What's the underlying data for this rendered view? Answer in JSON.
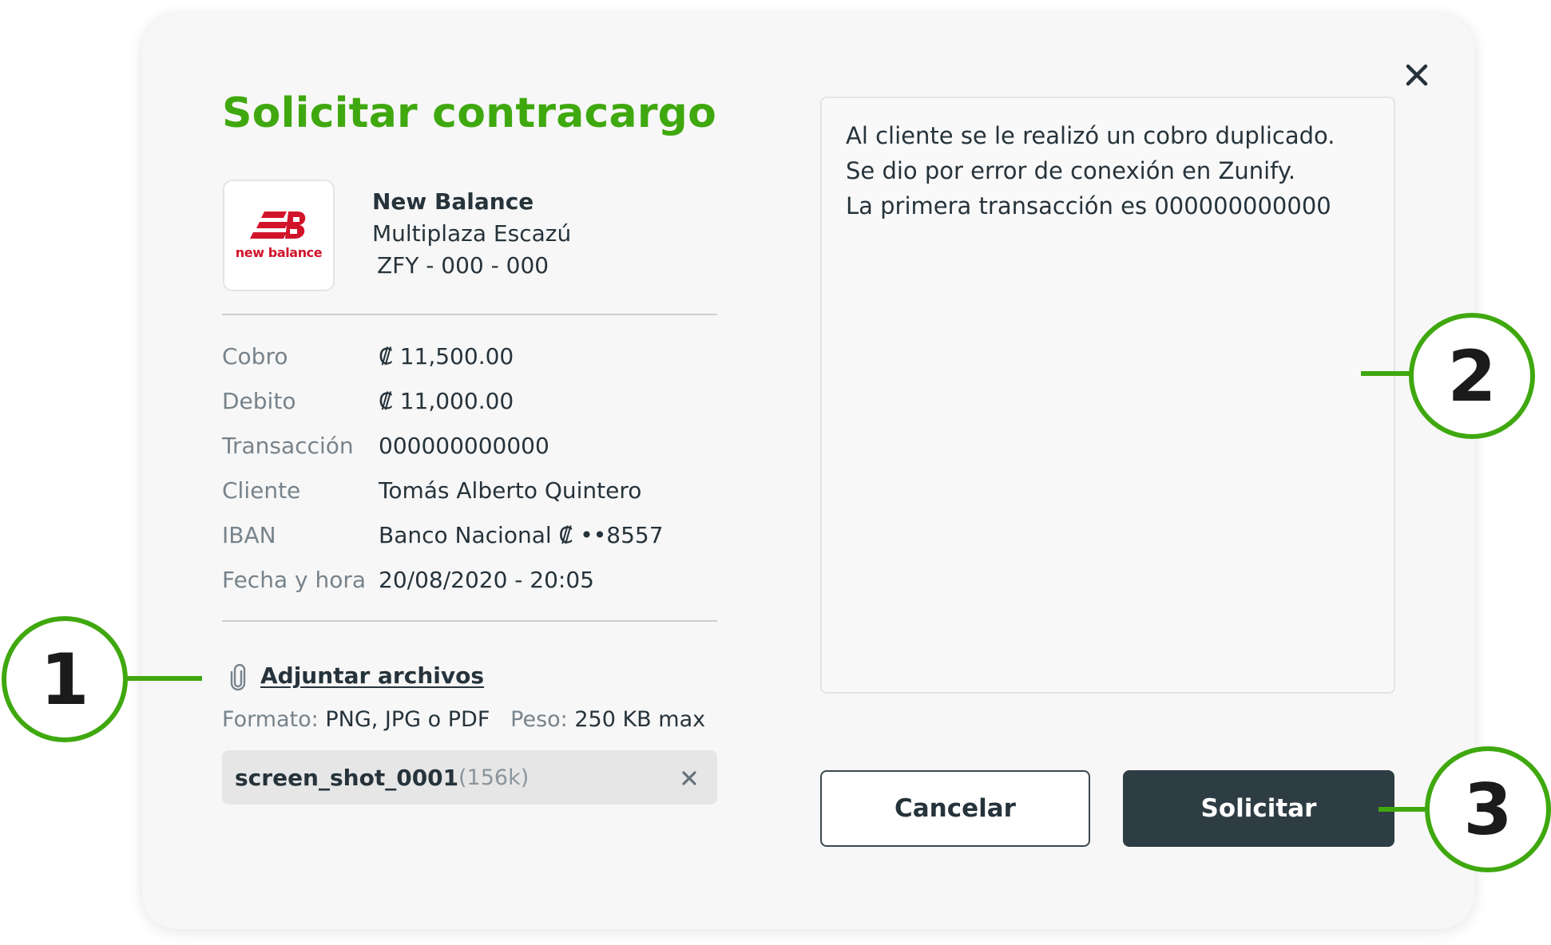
{
  "modal": {
    "title": "Solicitar contracargo",
    "close_icon": "close-icon"
  },
  "merchant": {
    "logo_text": "new balance",
    "name": "New Balance",
    "branch": "Multiplaza Escazú",
    "code": "ZFY - 000 - 000"
  },
  "details": [
    {
      "label": "Cobro",
      "value": "₡ 11,500.00"
    },
    {
      "label": "Debito",
      "value": "₡ 11,000.00"
    },
    {
      "label": "Transacción",
      "value": "000000000000"
    },
    {
      "label": "Cliente",
      "value": "Tomás Alberto Quintero"
    },
    {
      "label": "IBAN",
      "value": "Banco Nacional ₡ ••8557"
    },
    {
      "label": "Fecha y hora",
      "value": "20/08/2020 - 20:05"
    }
  ],
  "attachments": {
    "link_label": "Adjuntar archivos",
    "icon": "paperclip-icon",
    "format_label": "Formato:",
    "format_value": "PNG, JPG o PDF",
    "weight_label": "Peso:",
    "weight_value": "250 KB max",
    "file": {
      "name": "screen_shot_0001",
      "size": "(156k)",
      "remove_icon": "close-icon"
    }
  },
  "reason": {
    "lines": [
      "Al cliente se le realizó un cobro duplicado.",
      "Se dio por error de conexión en Zunify.",
      "La primera transacción es 000000000000"
    ]
  },
  "actions": {
    "cancel_label": "Cancelar",
    "submit_label": "Solicitar"
  },
  "callouts": [
    "1",
    "2",
    "3"
  ],
  "colors": {
    "accent": "#3fa80f",
    "primary_button": "#2e3d43",
    "brand_red": "#d2142b"
  }
}
